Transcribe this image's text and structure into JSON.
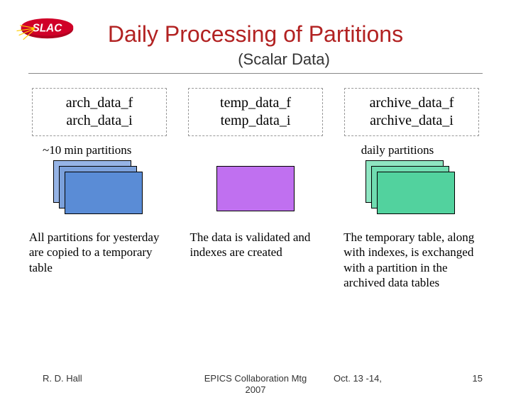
{
  "title": "Daily Processing of Partitions",
  "subtitle": "(Scalar Data)",
  "tables": {
    "arch": {
      "f": "arch_data_f",
      "i": "arch_data_i"
    },
    "temp": {
      "f": "temp_data_f",
      "i": "temp_data_i"
    },
    "archive": {
      "f": "archive_data_f",
      "i": "archive_data_i"
    }
  },
  "labels": {
    "left": "~10 min partitions",
    "right": "daily partitions"
  },
  "desc": {
    "left": "All partitions for yesterday are copied to a temporary table",
    "mid": "The data is validated and indexes are created",
    "right": "The temporary table, along with indexes, is exchanged with a partition in the archived data tables"
  },
  "footer": {
    "author": "R. D. Hall",
    "meeting_line1": "EPICS Collaboration Mtg",
    "meeting_line2": "2007",
    "date": "Oct. 13 -14,",
    "page": "15"
  }
}
